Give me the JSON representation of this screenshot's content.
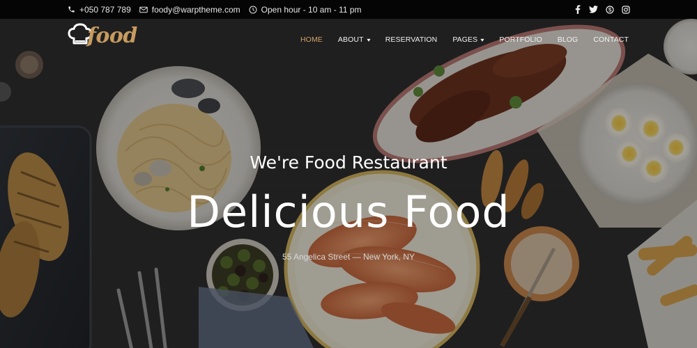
{
  "topbar": {
    "phone": "+050 787 789",
    "email": "foody@warptheme.com",
    "hours": "Open hour - 10 am - 11 pm",
    "icons": {
      "phone": "phone-icon",
      "email": "envelope-icon",
      "hours": "clock-icon",
      "social": [
        "facebook-icon",
        "twitter-icon",
        "skype-icon",
        "instagram-icon"
      ]
    }
  },
  "logo": {
    "text": "food",
    "icon": "chef-hat-icon"
  },
  "nav": {
    "items": [
      {
        "label": "HOME",
        "active": true
      },
      {
        "label": "ABOUT",
        "dropdown": true
      },
      {
        "label": "RESERVATION"
      },
      {
        "label": "PAGES",
        "dropdown": true
      },
      {
        "label": "PORTFOLIO"
      },
      {
        "label": "BLOG"
      },
      {
        "label": "CONTACT"
      }
    ]
  },
  "hero": {
    "tagline": "We're Food Restaurant",
    "headline": "Delicious Food",
    "address": "55 Angelica Street — New York, NY"
  },
  "colors": {
    "accent": "#c79a5f",
    "topbar_bg": "#050505",
    "text": "#ffffff"
  }
}
